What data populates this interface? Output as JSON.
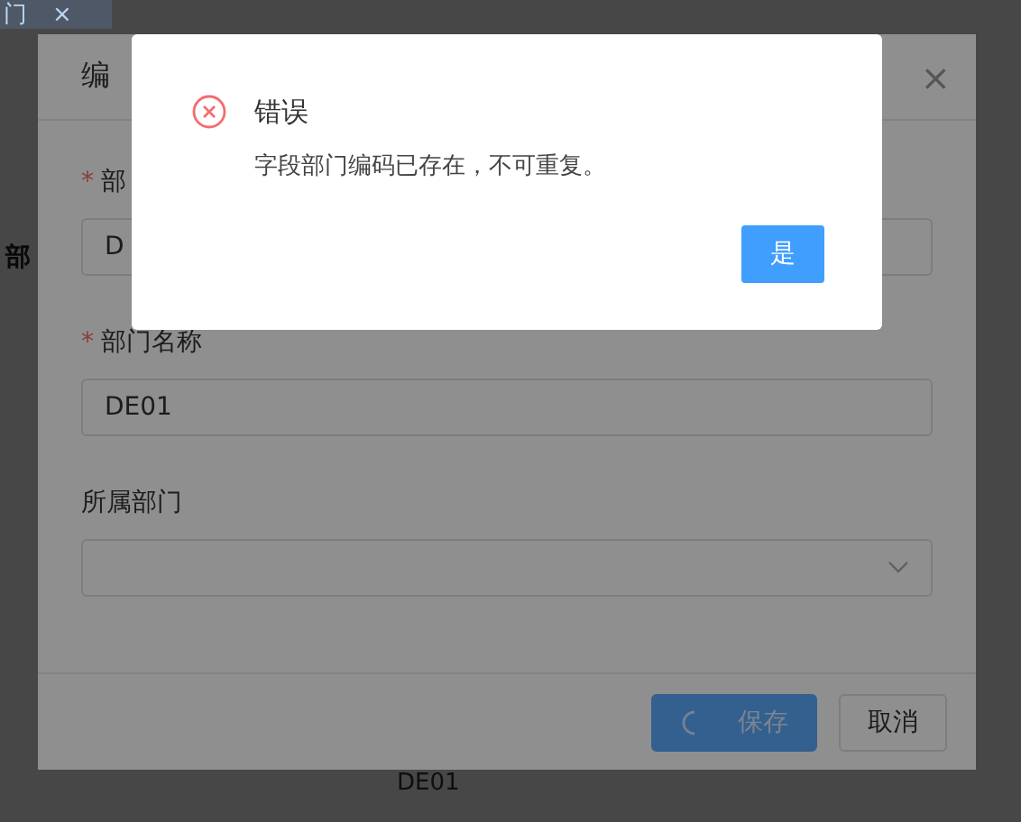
{
  "background": {
    "tab": {
      "label": "门",
      "close": "×"
    },
    "side_label": "部",
    "cell": "DE01"
  },
  "edit_dialog": {
    "title": "编",
    "close": "×",
    "fields": [
      {
        "kind": "input",
        "label": "部",
        "required": "*",
        "value": "D"
      },
      {
        "kind": "input",
        "label": "部门名称",
        "required": "*",
        "value": "DE01"
      },
      {
        "kind": "select",
        "label": "所属部门",
        "required": false
      }
    ],
    "buttons": [
      {
        "kind": "primary",
        "label": "保存",
        "loading": true
      },
      {
        "kind": "default",
        "label": "取消",
        "loading": false
      }
    ]
  },
  "error_dialog": {
    "title": "错误",
    "message": "字段部门编码已存在，不可重复。",
    "confirm": "是"
  }
}
